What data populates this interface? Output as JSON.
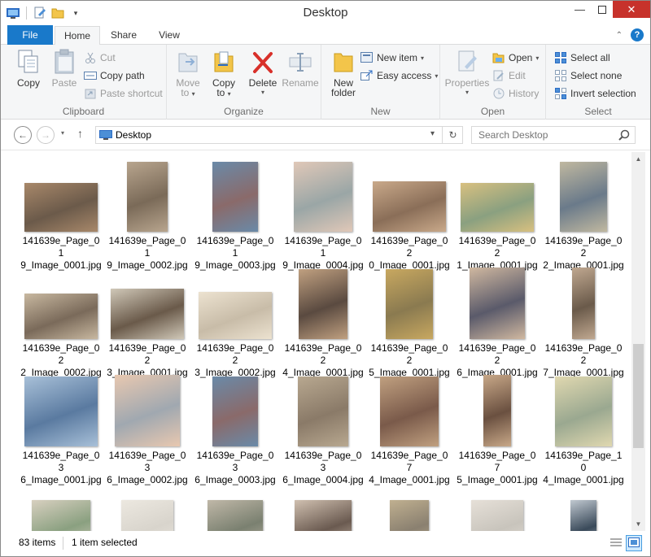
{
  "window": {
    "title": "Desktop"
  },
  "ribbon_tabs": [
    "File",
    "Home",
    "Share",
    "View"
  ],
  "ribbon": {
    "clipboard": {
      "label": "Clipboard",
      "copy": "Copy",
      "paste": "Paste",
      "cut": "Cut",
      "copy_path": "Copy path",
      "paste_shortcut": "Paste shortcut"
    },
    "organize": {
      "label": "Organize",
      "move_to": "Move",
      "move_to_2": "to",
      "copy_to": "Copy",
      "copy_to_2": "to",
      "delete": "Delete",
      "rename": "Rename"
    },
    "new": {
      "label": "New",
      "new_folder": "New",
      "new_folder_2": "folder",
      "new_item": "New item",
      "easy_access": "Easy access"
    },
    "open": {
      "label": "Open",
      "properties": "Properties",
      "open": "Open",
      "edit": "Edit",
      "history": "History"
    },
    "select": {
      "label": "Select",
      "select_all": "Select all",
      "select_none": "Select none",
      "invert_selection": "Invert selection"
    }
  },
  "address": {
    "path": "Desktop",
    "search_placeholder": "Search Desktop"
  },
  "files": [
    {
      "line1": "141639e_Page_01",
      "line2": "9_Image_0001.jpg"
    },
    {
      "line1": "141639e_Page_01",
      "line2": "9_Image_0002.jpg"
    },
    {
      "line1": "141639e_Page_01",
      "line2": "9_Image_0003.jpg"
    },
    {
      "line1": "141639e_Page_01",
      "line2": "9_Image_0004.jpg"
    },
    {
      "line1": "141639e_Page_02",
      "line2": "0_Image_0001.jpg"
    },
    {
      "line1": "141639e_Page_02",
      "line2": "1_Image_0001.jpg"
    },
    {
      "line1": "141639e_Page_02",
      "line2": "2_Image_0001.jpg"
    },
    {
      "line1": "141639e_Page_02",
      "line2": "2_Image_0002.jpg"
    },
    {
      "line1": "141639e_Page_02",
      "line2": "3_Image_0001.jpg"
    },
    {
      "line1": "141639e_Page_02",
      "line2": "3_Image_0002.jpg"
    },
    {
      "line1": "141639e_Page_02",
      "line2": "4_Image_0001.jpg"
    },
    {
      "line1": "141639e_Page_02",
      "line2": "5_Image_0001.jpg"
    },
    {
      "line1": "141639e_Page_02",
      "line2": "6_Image_0001.jpg"
    },
    {
      "line1": "141639e_Page_02",
      "line2": "7_Image_0001.jpg"
    },
    {
      "line1": "141639e_Page_03",
      "line2": "6_Image_0001.jpg"
    },
    {
      "line1": "141639e_Page_03",
      "line2": "6_Image_0002.jpg"
    },
    {
      "line1": "141639e_Page_03",
      "line2": "6_Image_0003.jpg"
    },
    {
      "line1": "141639e_Page_03",
      "line2": "6_Image_0004.jpg"
    },
    {
      "line1": "141639e_Page_07",
      "line2": "4_Image_0001.jpg"
    },
    {
      "line1": "141639e_Page_07",
      "line2": "5_Image_0001.jpg"
    },
    {
      "line1": "141639e_Page_10",
      "line2": "4_Image_0001.jpg"
    }
  ],
  "status": {
    "item_count": "83 items",
    "selection": "1 item selected"
  },
  "colors": {
    "accent": "#1979ca",
    "close": "#c7322b"
  }
}
